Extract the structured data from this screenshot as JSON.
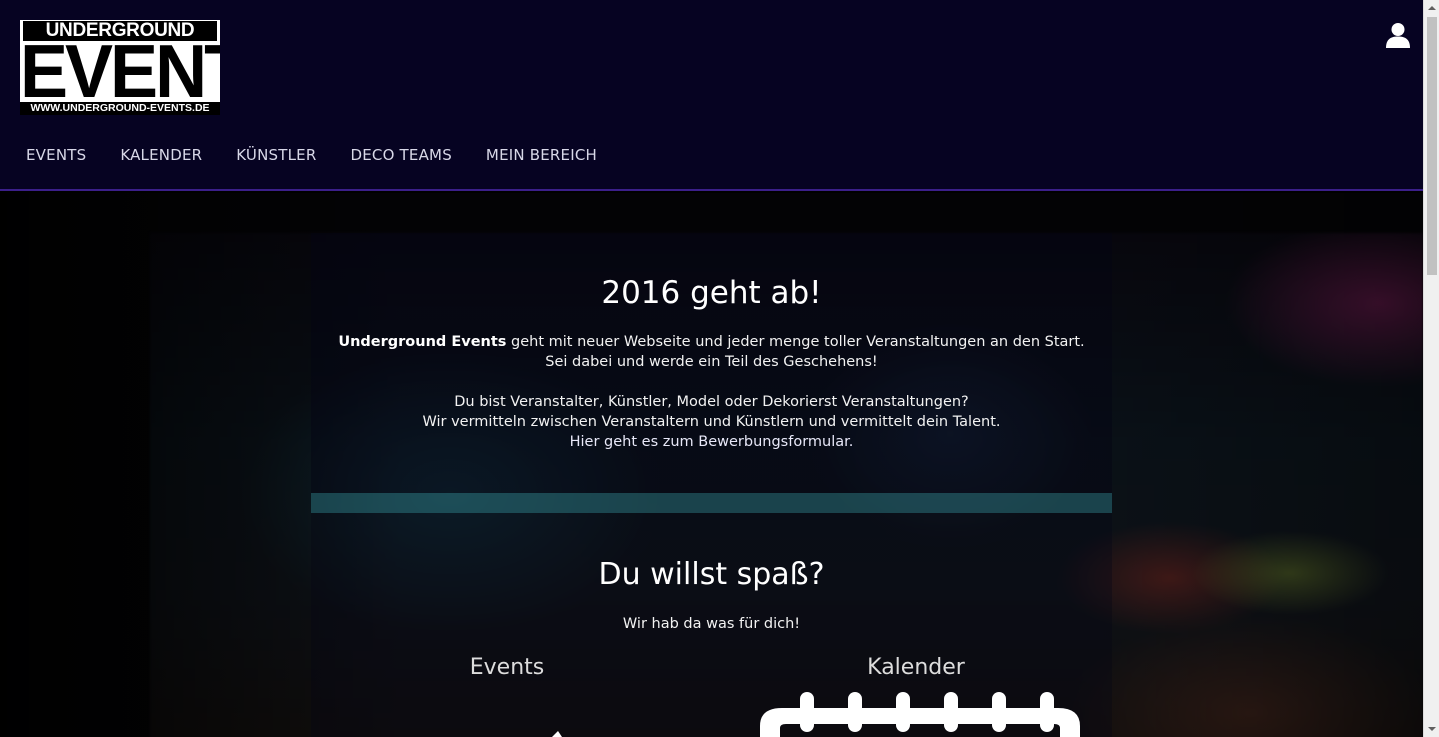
{
  "logo": {
    "line1": "UNDERGROUND",
    "line2": "EVENTS",
    "line3": "WWW.UNDERGROUND-EVENTS.DE"
  },
  "header": {
    "user_icon": "user-icon",
    "nav": [
      {
        "label": "EVENTS"
      },
      {
        "label": "KALENDER"
      },
      {
        "label": "KÜNSTLER"
      },
      {
        "label": "DECO TEAMS"
      },
      {
        "label": "MEIN BEREICH"
      }
    ]
  },
  "hero": {
    "title": "2016 geht ab!",
    "intro_brand": "Underground Events",
    "intro_line1_rest": " geht mit neuer Webseite und jeder menge toller Veranstaltungen an den Start.",
    "intro_line2": "Sei dabei und werde ein Teil des Geschehens!",
    "intro_line3": "Du bist Veranstalter, Künstler, Model oder Dekorierst Veranstaltungen?",
    "intro_line4": "Wir vermitteln zwischen Veranstaltern und Künstlern und vermittelt dein Talent.",
    "intro_link": "Hier geht es zum Bewerbungsformular."
  },
  "fun": {
    "title": "Du willst spaß?",
    "subtitle": "Wir hab da was für dich!",
    "col_events": "Events",
    "col_kalender": "Kalender",
    "events_icon": "events-icon",
    "kalender_icon": "calendar-icon"
  },
  "colors": {
    "header_bg": "#060322",
    "header_border": "#3b1f8a",
    "nav_text": "#d8d8e8"
  }
}
